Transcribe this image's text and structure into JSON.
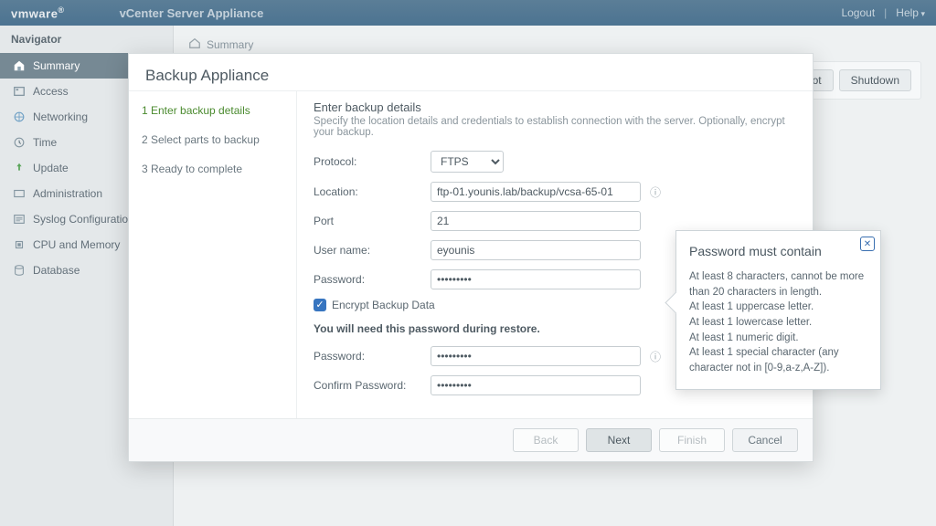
{
  "brand": "vmware",
  "product": "vCenter Server Appliance",
  "top_right": {
    "logout": "Logout",
    "help": "Help"
  },
  "nav": {
    "header": "Navigator",
    "items": [
      {
        "label": "Summary"
      },
      {
        "label": "Access"
      },
      {
        "label": "Networking"
      },
      {
        "label": "Time"
      },
      {
        "label": "Update"
      },
      {
        "label": "Administration"
      },
      {
        "label": "Syslog Configuration"
      },
      {
        "label": "CPU and Memory"
      },
      {
        "label": "Database"
      }
    ]
  },
  "breadcrumb": "Summary",
  "page_actions": {
    "reboot": "Reboot",
    "shutdown": "Shutdown"
  },
  "modal": {
    "title": "Backup Appliance",
    "steps": [
      "1 Enter backup details",
      "2 Select parts to backup",
      "3 Ready to complete"
    ],
    "section_title": "Enter backup details",
    "section_sub": "Specify the location details and credentials to establish connection with the server. Optionally, encrypt your backup.",
    "labels": {
      "protocol": "Protocol:",
      "location": "Location:",
      "port": "Port",
      "username": "User name:",
      "password": "Password:",
      "encrypt": "Encrypt Backup Data",
      "restore_note": "You will need this password during restore.",
      "encrypt_password": "Password:",
      "confirm_password": "Confirm Password:"
    },
    "values": {
      "protocol": "FTPS",
      "location": "ftp-01.younis.lab/backup/vcsa-65-01",
      "port": "21",
      "username": "eyounis",
      "password": "•••••••••",
      "encrypt_password": "•••••••••",
      "confirm_password": "•••••••••"
    },
    "footer": {
      "back": "Back",
      "next": "Next",
      "finish": "Finish",
      "cancel": "Cancel"
    }
  },
  "tooltip": {
    "title": "Password must contain",
    "lines": [
      "At least 8 characters, cannot be more than 20 characters in length.",
      "At least 1 uppercase letter.",
      "At least 1 lowercase letter.",
      "At least 1 numeric digit.",
      "At least 1 special character (any character not in [0-9,a-z,A-Z])."
    ]
  }
}
